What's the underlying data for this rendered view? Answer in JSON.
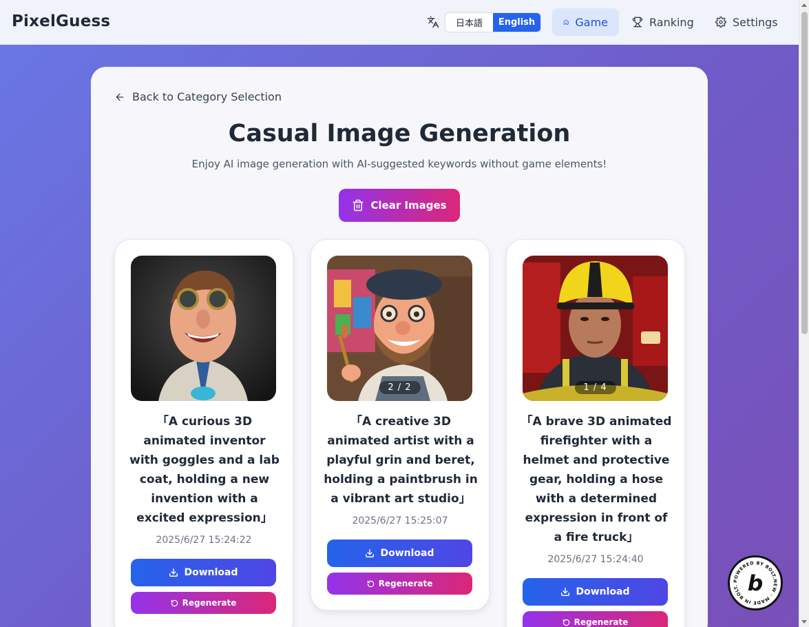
{
  "header": {
    "brand": "PixelGuess",
    "languages": [
      {
        "label": "日本語",
        "active": false
      },
      {
        "label": "English",
        "active": true
      }
    ],
    "nav": [
      {
        "label": "Game",
        "icon": "home-icon",
        "active": true
      },
      {
        "label": "Ranking",
        "icon": "trophy-icon",
        "active": false
      },
      {
        "label": "Settings",
        "icon": "gear-icon",
        "active": false
      }
    ]
  },
  "main": {
    "back_label": "Back to Category Selection",
    "title": "Casual Image Generation",
    "subtitle": "Enjoy AI image generation with AI-suggested keywords without game elements!",
    "clear_label": "Clear Images"
  },
  "cards": [
    {
      "prompt": "「A curious 3D animated inventor with goggles and a lab coat, holding a new invention with a excited expression」",
      "timestamp": "2025/6/27 15:24:22",
      "counter": "",
      "download_label": "Download",
      "regenerate_label": "Regenerate"
    },
    {
      "prompt": "「A creative 3D animated artist with a playful grin and beret, holding a paintbrush in a vibrant art studio」",
      "timestamp": "2025/6/27 15:25:07",
      "counter": "2 / 2",
      "download_label": "Download",
      "regenerate_label": "Regenerate"
    },
    {
      "prompt": "「A brave 3D animated firefighter with a helmet and protective gear, holding a hose with a determined expression in front of a fire truck」",
      "timestamp": "2025/6/27 15:24:40",
      "counter": "1 / 4",
      "download_label": "Download",
      "regenerate_label": "Regenerate"
    }
  ],
  "badge": {
    "text": "POWERED BY BOLT.NEW · MADE IN BOLT.NEW ·",
    "letter": "b"
  },
  "colors": {
    "accent_blue": "#2563eb",
    "accent_purple": "#9333ea",
    "accent_pink": "#db2777"
  }
}
